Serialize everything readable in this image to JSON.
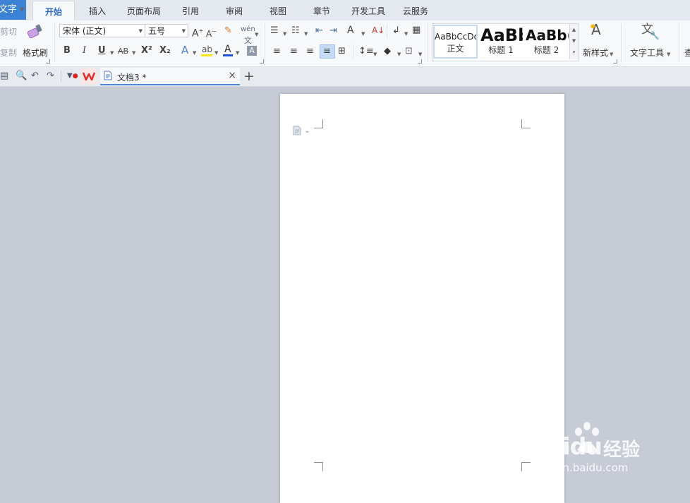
{
  "app": {
    "menu_label": "文字"
  },
  "menu_tabs": [
    {
      "label": "开始",
      "active": true
    },
    {
      "label": "插入"
    },
    {
      "label": "页面布局"
    },
    {
      "label": "引用"
    },
    {
      "label": "审阅"
    },
    {
      "label": "视图"
    },
    {
      "label": "章节"
    },
    {
      "label": "开发工具"
    },
    {
      "label": "云服务"
    }
  ],
  "clipboard": {
    "cut": "剪切",
    "copy": "复制",
    "format_painter": "格式刷"
  },
  "font": {
    "family": "宋体 (正文)",
    "size": "五号"
  },
  "font_buttons": {
    "bold": "B",
    "italic": "I",
    "underline": "U",
    "strike": "AB",
    "superscript": "X²",
    "subscript": "X₂",
    "color": "A"
  },
  "styles": [
    {
      "preview": "AaBbCcDd",
      "name": "正文",
      "selected": true
    },
    {
      "preview": "AaBb",
      "name": "标题 1"
    },
    {
      "preview": "AaBb(",
      "name": "标题 2"
    }
  ],
  "new_style": "新样式",
  "text_tools": "文字工具",
  "find_partial": "查",
  "document_tab": {
    "name": "文档3 *"
  },
  "watermark": {
    "brand": "Baidu",
    "suffix": "经验",
    "url": "jingyan.baidu.com"
  },
  "colors": {
    "accent": "#3d83d5",
    "highlight": "#ffe800",
    "font_color": "#e0271e",
    "canvas": "#c6cbd6"
  }
}
